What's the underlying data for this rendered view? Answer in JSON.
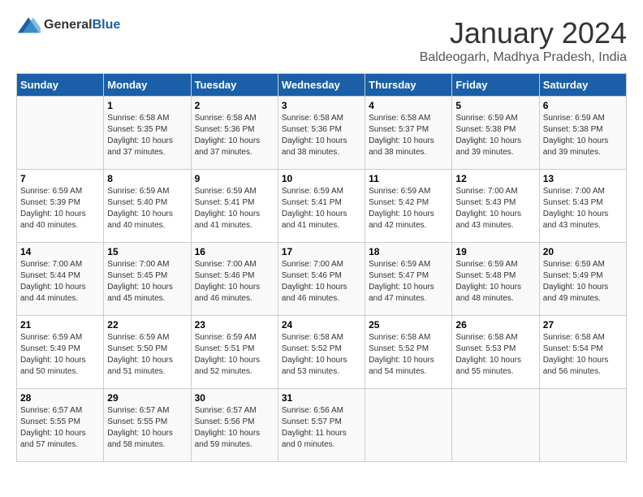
{
  "logo": {
    "general": "General",
    "blue": "Blue"
  },
  "title": "January 2024",
  "subtitle": "Baldeogarh, Madhya Pradesh, India",
  "days_header": [
    "Sunday",
    "Monday",
    "Tuesday",
    "Wednesday",
    "Thursday",
    "Friday",
    "Saturday"
  ],
  "weeks": [
    [
      {
        "day": "",
        "info": ""
      },
      {
        "day": "1",
        "info": "Sunrise: 6:58 AM\nSunset: 5:35 PM\nDaylight: 10 hours\nand 37 minutes."
      },
      {
        "day": "2",
        "info": "Sunrise: 6:58 AM\nSunset: 5:36 PM\nDaylight: 10 hours\nand 37 minutes."
      },
      {
        "day": "3",
        "info": "Sunrise: 6:58 AM\nSunset: 5:36 PM\nDaylight: 10 hours\nand 38 minutes."
      },
      {
        "day": "4",
        "info": "Sunrise: 6:58 AM\nSunset: 5:37 PM\nDaylight: 10 hours\nand 38 minutes."
      },
      {
        "day": "5",
        "info": "Sunrise: 6:59 AM\nSunset: 5:38 PM\nDaylight: 10 hours\nand 39 minutes."
      },
      {
        "day": "6",
        "info": "Sunrise: 6:59 AM\nSunset: 5:38 PM\nDaylight: 10 hours\nand 39 minutes."
      }
    ],
    [
      {
        "day": "7",
        "info": "Sunrise: 6:59 AM\nSunset: 5:39 PM\nDaylight: 10 hours\nand 40 minutes."
      },
      {
        "day": "8",
        "info": "Sunrise: 6:59 AM\nSunset: 5:40 PM\nDaylight: 10 hours\nand 40 minutes."
      },
      {
        "day": "9",
        "info": "Sunrise: 6:59 AM\nSunset: 5:41 PM\nDaylight: 10 hours\nand 41 minutes."
      },
      {
        "day": "10",
        "info": "Sunrise: 6:59 AM\nSunset: 5:41 PM\nDaylight: 10 hours\nand 41 minutes."
      },
      {
        "day": "11",
        "info": "Sunrise: 6:59 AM\nSunset: 5:42 PM\nDaylight: 10 hours\nand 42 minutes."
      },
      {
        "day": "12",
        "info": "Sunrise: 7:00 AM\nSunset: 5:43 PM\nDaylight: 10 hours\nand 43 minutes."
      },
      {
        "day": "13",
        "info": "Sunrise: 7:00 AM\nSunset: 5:43 PM\nDaylight: 10 hours\nand 43 minutes."
      }
    ],
    [
      {
        "day": "14",
        "info": "Sunrise: 7:00 AM\nSunset: 5:44 PM\nDaylight: 10 hours\nand 44 minutes."
      },
      {
        "day": "15",
        "info": "Sunrise: 7:00 AM\nSunset: 5:45 PM\nDaylight: 10 hours\nand 45 minutes."
      },
      {
        "day": "16",
        "info": "Sunrise: 7:00 AM\nSunset: 5:46 PM\nDaylight: 10 hours\nand 46 minutes."
      },
      {
        "day": "17",
        "info": "Sunrise: 7:00 AM\nSunset: 5:46 PM\nDaylight: 10 hours\nand 46 minutes."
      },
      {
        "day": "18",
        "info": "Sunrise: 6:59 AM\nSunset: 5:47 PM\nDaylight: 10 hours\nand 47 minutes."
      },
      {
        "day": "19",
        "info": "Sunrise: 6:59 AM\nSunset: 5:48 PM\nDaylight: 10 hours\nand 48 minutes."
      },
      {
        "day": "20",
        "info": "Sunrise: 6:59 AM\nSunset: 5:49 PM\nDaylight: 10 hours\nand 49 minutes."
      }
    ],
    [
      {
        "day": "21",
        "info": "Sunrise: 6:59 AM\nSunset: 5:49 PM\nDaylight: 10 hours\nand 50 minutes."
      },
      {
        "day": "22",
        "info": "Sunrise: 6:59 AM\nSunset: 5:50 PM\nDaylight: 10 hours\nand 51 minutes."
      },
      {
        "day": "23",
        "info": "Sunrise: 6:59 AM\nSunset: 5:51 PM\nDaylight: 10 hours\nand 52 minutes."
      },
      {
        "day": "24",
        "info": "Sunrise: 6:58 AM\nSunset: 5:52 PM\nDaylight: 10 hours\nand 53 minutes."
      },
      {
        "day": "25",
        "info": "Sunrise: 6:58 AM\nSunset: 5:52 PM\nDaylight: 10 hours\nand 54 minutes."
      },
      {
        "day": "26",
        "info": "Sunrise: 6:58 AM\nSunset: 5:53 PM\nDaylight: 10 hours\nand 55 minutes."
      },
      {
        "day": "27",
        "info": "Sunrise: 6:58 AM\nSunset: 5:54 PM\nDaylight: 10 hours\nand 56 minutes."
      }
    ],
    [
      {
        "day": "28",
        "info": "Sunrise: 6:57 AM\nSunset: 5:55 PM\nDaylight: 10 hours\nand 57 minutes."
      },
      {
        "day": "29",
        "info": "Sunrise: 6:57 AM\nSunset: 5:55 PM\nDaylight: 10 hours\nand 58 minutes."
      },
      {
        "day": "30",
        "info": "Sunrise: 6:57 AM\nSunset: 5:56 PM\nDaylight: 10 hours\nand 59 minutes."
      },
      {
        "day": "31",
        "info": "Sunrise: 6:56 AM\nSunset: 5:57 PM\nDaylight: 11 hours\nand 0 minutes."
      },
      {
        "day": "",
        "info": ""
      },
      {
        "day": "",
        "info": ""
      },
      {
        "day": "",
        "info": ""
      }
    ]
  ]
}
